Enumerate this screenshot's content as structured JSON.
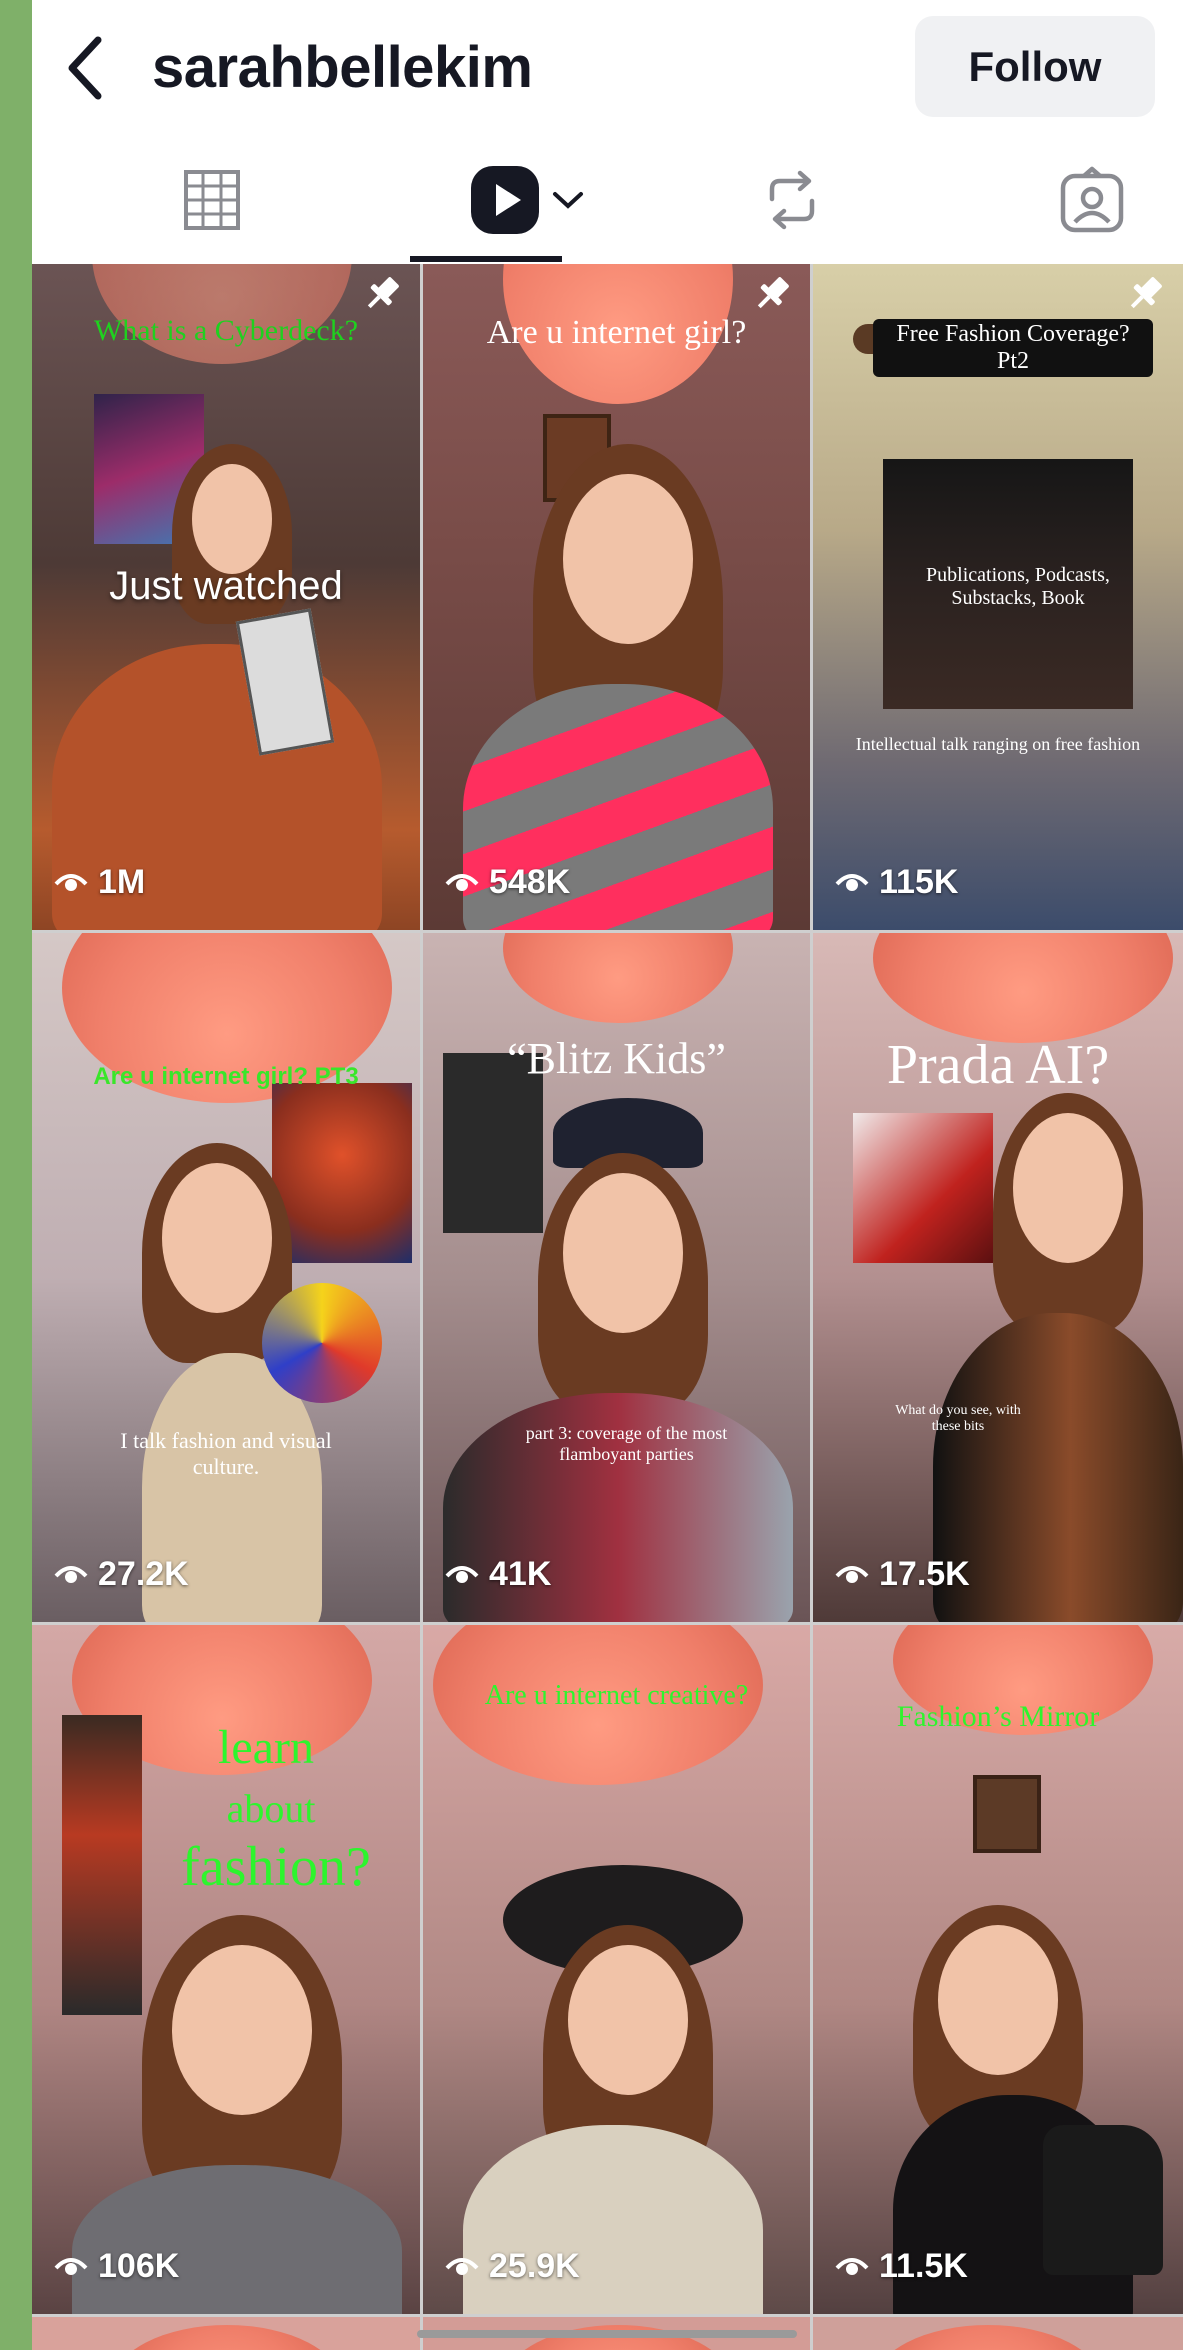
{
  "header": {
    "username": "sarahbellekim",
    "follow_label": "Follow"
  },
  "tabs": [
    {
      "name": "grid-icon"
    },
    {
      "name": "play-icon",
      "active": true
    },
    {
      "name": "repost-icon"
    },
    {
      "name": "tagged-icon"
    }
  ],
  "videos": [
    {
      "views": "1M",
      "pinned": true,
      "caption": "What is a Cyberdeck?",
      "caption2": "Just watched",
      "caption_color": "#1fd11f"
    },
    {
      "views": "548K",
      "pinned": true,
      "caption": "Are u internet girl?",
      "caption_color": "#ffffff"
    },
    {
      "views": "115K",
      "pinned": true,
      "caption": "Free Fashion Coverage? Pt2",
      "caption2": "Publications, Podcasts, Substacks, Book",
      "caption3": "Intellectual talk ranging on free fashion",
      "caption_color": "#ffffff"
    },
    {
      "views": "27.2K",
      "caption": "Are u internet girl? PT3",
      "caption2": "I talk fashion and visual culture.",
      "caption_color": "#39e62a"
    },
    {
      "views": "41K",
      "caption": "“Blitz Kids”",
      "caption2": "part 3: coverage of the most flamboyant parties",
      "caption_color": "#ffffff"
    },
    {
      "views": "17.5K",
      "caption": "Prada AI?",
      "caption2": "What do you see, with these bits",
      "caption_color": "#ffffff"
    },
    {
      "views": "106K",
      "caption": "learn",
      "caption2": "about",
      "caption3": "fashion?",
      "caption_color": "#2df52d"
    },
    {
      "views": "25.9K",
      "caption": "Are u internet creative?",
      "caption_color": "#2df52d"
    },
    {
      "views": "11.5K",
      "caption": "Fashion’s Mirror",
      "caption_color": "#2df52d"
    }
  ],
  "colors": {
    "text": "#161823",
    "follow_bg": "#f0f1f3",
    "backdrop": "#7fb069"
  }
}
